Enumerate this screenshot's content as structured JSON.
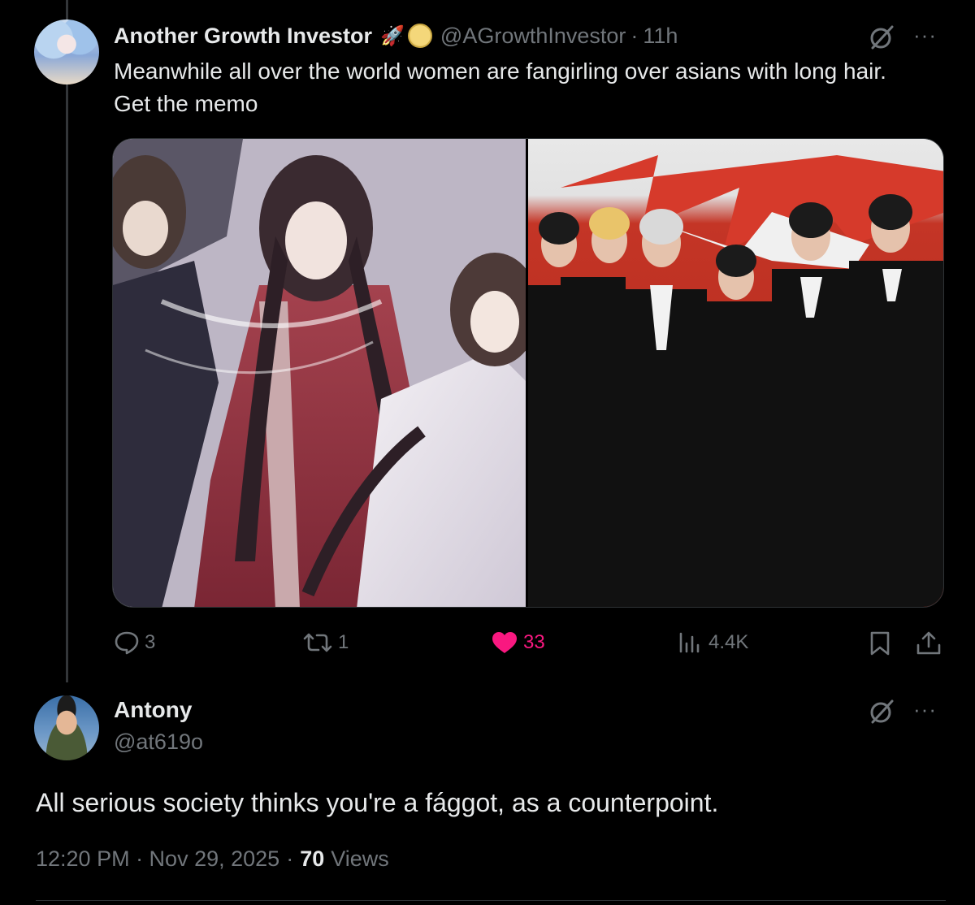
{
  "tweet": {
    "author_name": "Another Growth Investor",
    "author_emoji": "🚀",
    "author_handle": "@AGrowthInvestor",
    "separator": "·",
    "time": "11h",
    "text": "Meanwhile all over the world women are fangirling over asians with long hair. Get the memo",
    "stats": {
      "replies": "3",
      "retweets": "1",
      "likes": "33",
      "views": "4.4K"
    },
    "like_color": "#f91880"
  },
  "reply": {
    "author_name": "Antony",
    "author_handle": "@at619o",
    "text": "All serious society thinks you're a fággot, as a counterpoint.",
    "timestamp": "12:20 PM · Nov 29, 2025",
    "separator": "·",
    "views_count": "70",
    "views_label": "Views"
  },
  "icons": {
    "grok": "grok-icon",
    "more": "more-icon",
    "reply": "reply-icon",
    "retweet": "retweet-icon",
    "like": "heart-icon",
    "views": "views-chart-icon",
    "bookmark": "bookmark-icon",
    "share": "share-icon",
    "more_glyph": "···"
  },
  "colors": {
    "background": "#000000",
    "text": "#e7e9ea",
    "muted": "#71767b",
    "like": "#f91880",
    "border": "#2f3336"
  }
}
